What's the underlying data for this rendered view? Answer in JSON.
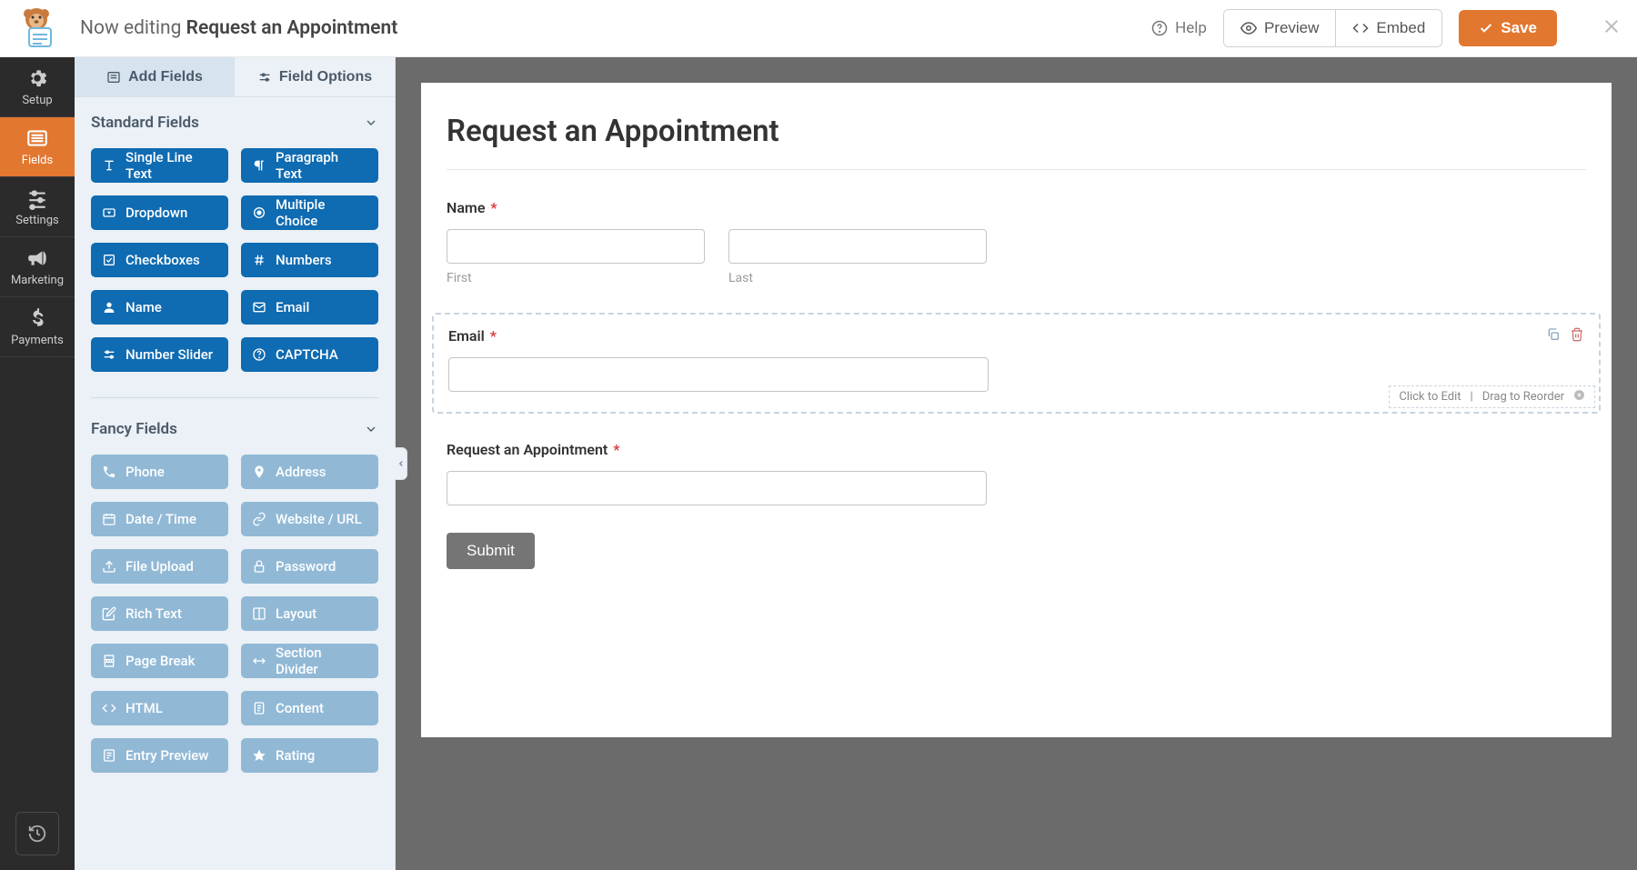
{
  "header": {
    "prefix": "Now editing ",
    "form_name": "Request an Appointment",
    "help_label": "Help",
    "preview_label": "Preview",
    "embed_label": "Embed",
    "save_label": "Save"
  },
  "sidebar": {
    "items": [
      {
        "label": "Setup",
        "icon": "gear"
      },
      {
        "label": "Fields",
        "icon": "list",
        "active": true
      },
      {
        "label": "Settings",
        "icon": "sliders"
      },
      {
        "label": "Marketing",
        "icon": "bullhorn"
      },
      {
        "label": "Payments",
        "icon": "dollar"
      }
    ]
  },
  "panel": {
    "tabs": {
      "add_fields": "Add Fields",
      "field_options": "Field Options"
    },
    "standard_heading": "Standard Fields",
    "standard": [
      {
        "label": "Single Line Text",
        "icon": "text"
      },
      {
        "label": "Paragraph Text",
        "icon": "paragraph"
      },
      {
        "label": "Dropdown",
        "icon": "dropdown"
      },
      {
        "label": "Multiple Choice",
        "icon": "radio"
      },
      {
        "label": "Checkboxes",
        "icon": "check"
      },
      {
        "label": "Numbers",
        "icon": "hash"
      },
      {
        "label": "Name",
        "icon": "user"
      },
      {
        "label": "Email",
        "icon": "mail"
      },
      {
        "label": "Number Slider",
        "icon": "slider"
      },
      {
        "label": "CAPTCHA",
        "icon": "question"
      }
    ],
    "fancy_heading": "Fancy Fields",
    "fancy": [
      {
        "label": "Phone",
        "icon": "phone"
      },
      {
        "label": "Address",
        "icon": "pin"
      },
      {
        "label": "Date / Time",
        "icon": "calendar"
      },
      {
        "label": "Website / URL",
        "icon": "link"
      },
      {
        "label": "File Upload",
        "icon": "upload"
      },
      {
        "label": "Password",
        "icon": "lock"
      },
      {
        "label": "Rich Text",
        "icon": "edit"
      },
      {
        "label": "Layout",
        "icon": "layout"
      },
      {
        "label": "Page Break",
        "icon": "pagebreak"
      },
      {
        "label": "Section Divider",
        "icon": "divider"
      },
      {
        "label": "HTML",
        "icon": "code"
      },
      {
        "label": "Content",
        "icon": "doc"
      },
      {
        "label": "Entry Preview",
        "icon": "preview"
      },
      {
        "label": "Rating",
        "icon": "star"
      }
    ]
  },
  "form": {
    "title": "Request an Appointment",
    "name_label": "Name",
    "first_sublabel": "First",
    "last_sublabel": "Last",
    "email_label": "Email",
    "appointment_label": "Request an Appointment",
    "submit_label": "Submit",
    "hint_edit": "Click to Edit",
    "hint_reorder": "Drag to Reorder"
  },
  "colors": {
    "accent_orange": "#e27730",
    "field_blue": "#0f6bb2",
    "fancy_blue": "#91b9d6",
    "canvas_bg": "#6b6b6b"
  }
}
